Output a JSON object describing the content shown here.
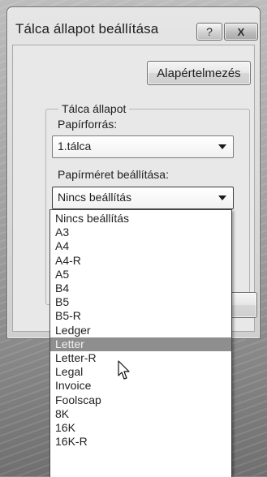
{
  "window": {
    "title": "Tálca állapot beállítása",
    "help_label": "?",
    "close_label": "X"
  },
  "buttons": {
    "default_label": "Alapértelmezés"
  },
  "group": {
    "legend": "Tálca állapot",
    "paper_source_label": "Papírforrás:",
    "paper_source_value": "1.tálca",
    "paper_size_label": "Papírméret beállítása:",
    "paper_size_value": "Nincs beállítás"
  },
  "dropdown": {
    "selected_index": 10,
    "options": [
      "Nincs beállítás",
      "A3",
      "A4",
      "A4-R",
      "A5",
      "B4",
      "B5",
      "B5-R",
      "Ledger",
      "Letter",
      "Letter-R",
      "Legal",
      "Invoice",
      "Foolscap",
      "8K",
      "16K",
      "16K-R"
    ]
  },
  "icons": {
    "dropdown_arrow": "chevron-down-icon",
    "cursor": "mouse-pointer-icon"
  }
}
